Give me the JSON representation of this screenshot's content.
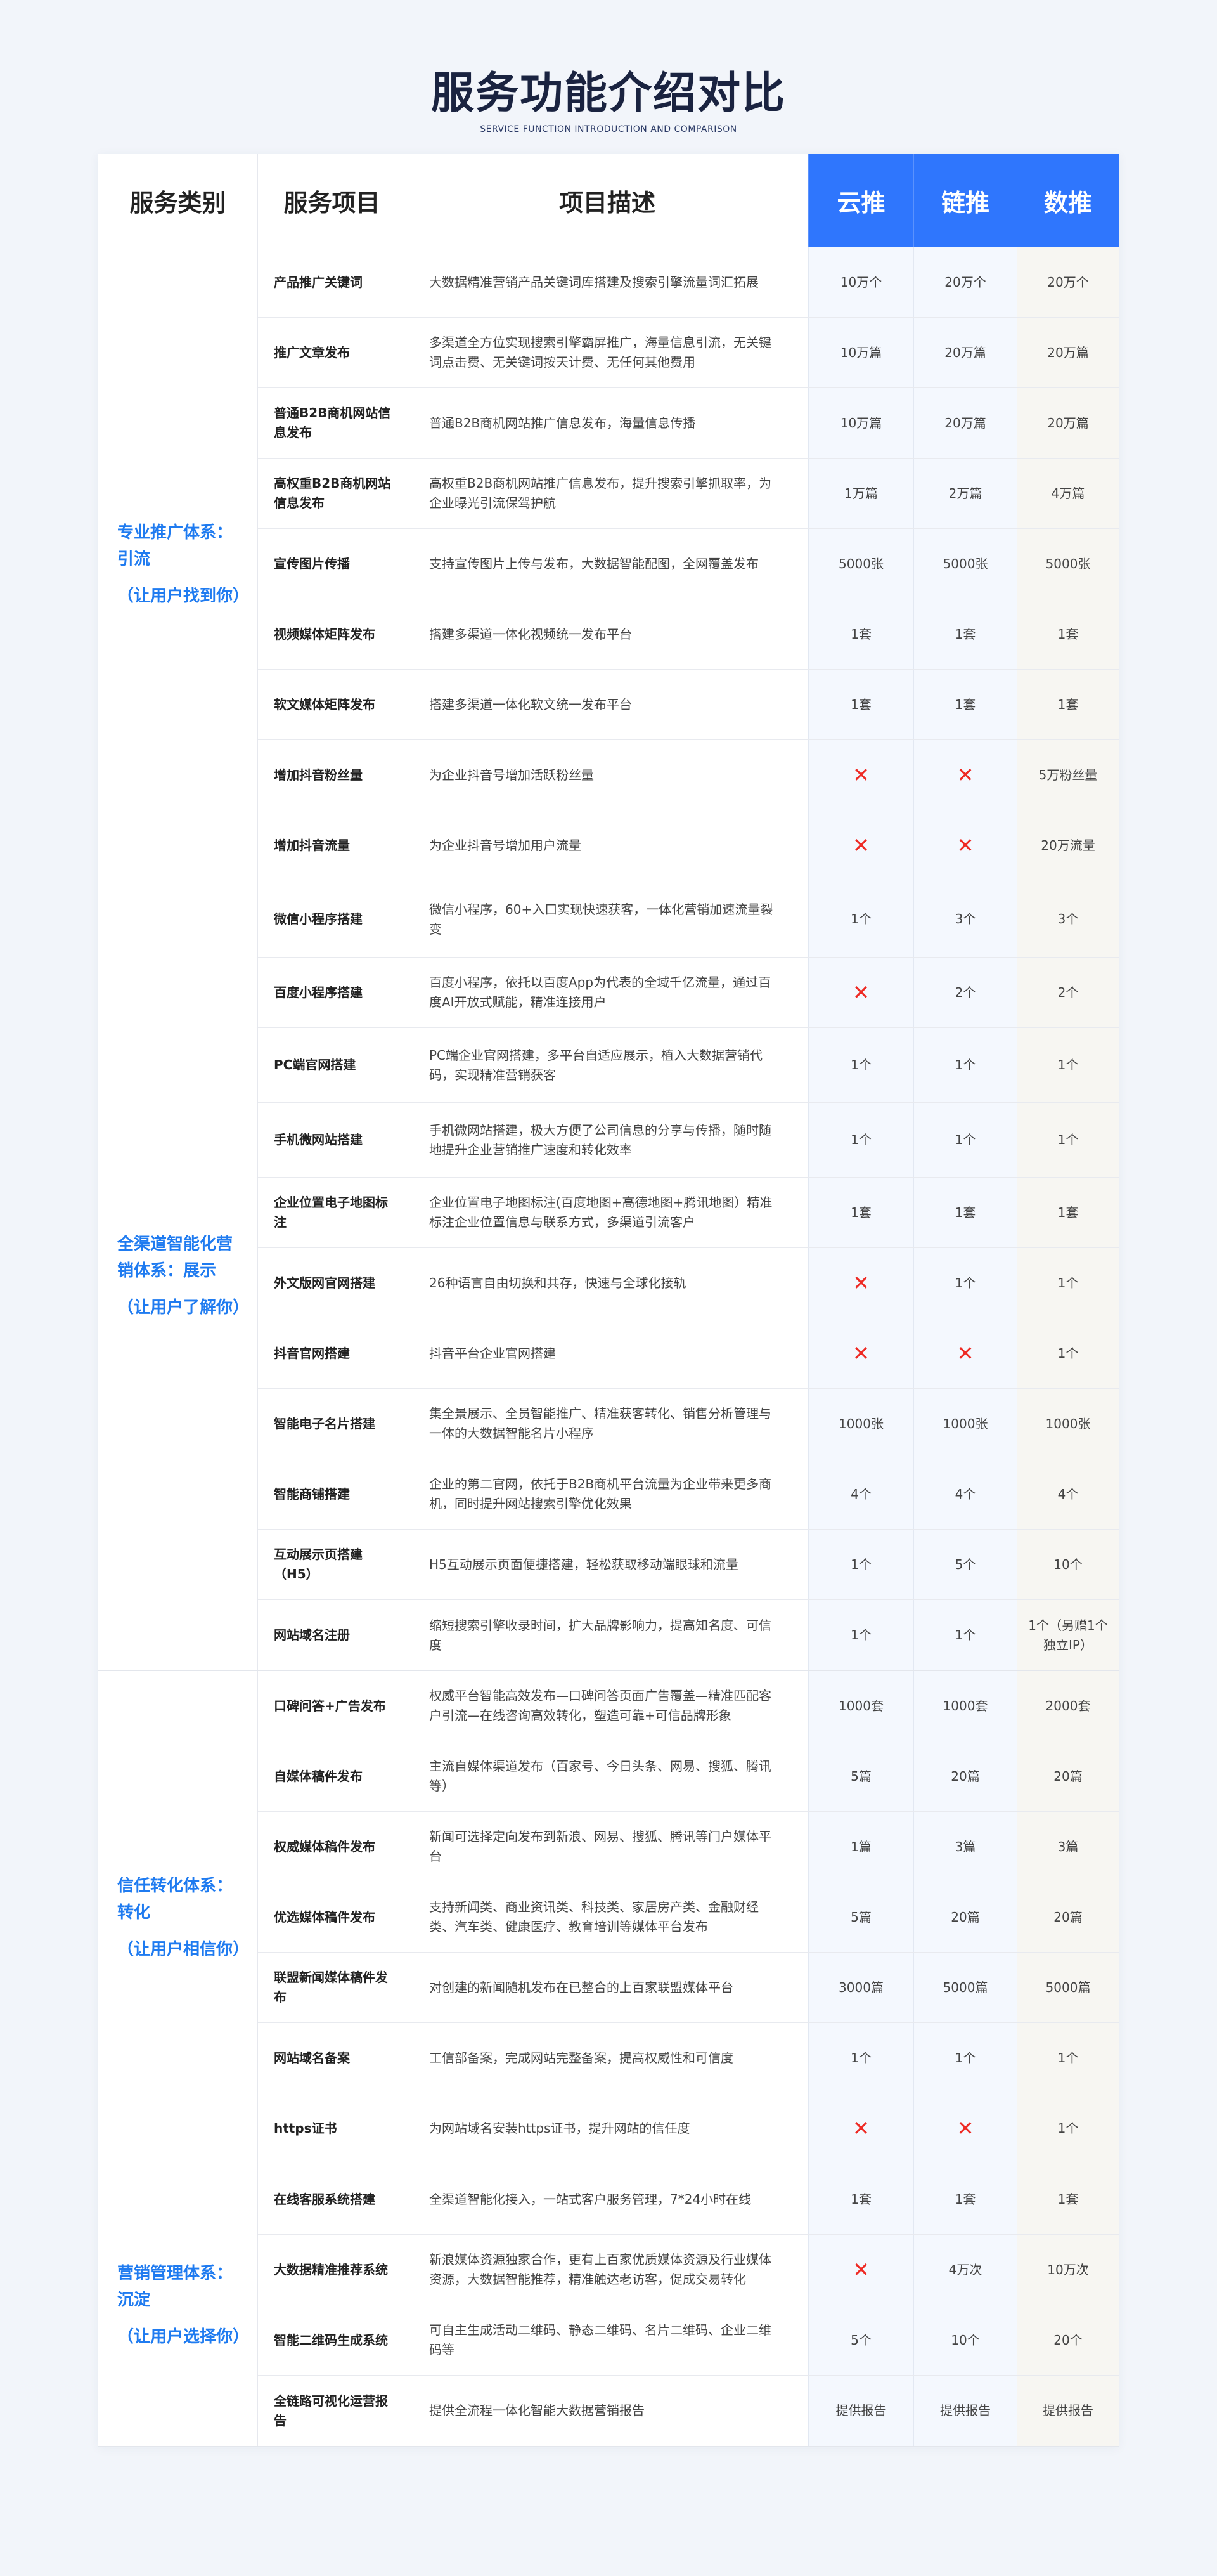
{
  "title": "服务功能介绍对比",
  "subtitle": "SERVICE FUNCTION INTRODUCTION AND COMPARISON",
  "headers": {
    "category": "服务类别",
    "item": "服务项目",
    "desc": "项目描述",
    "plan1": "云推",
    "plan2": "链推",
    "plan3": "数推"
  },
  "colors": {
    "accent": "#2f76fd",
    "category_text": "#1f7bf0",
    "cross": "#ee2a24"
  },
  "cross_icon": "red-x-icon",
  "sections": [
    {
      "title": "专业推广体系：引流",
      "sub": "（让用户找到你）",
      "rows": [
        {
          "item": "产品推广关键词",
          "desc": "大数据精准营销产品关键词库搭建及搜索引擎流量词汇拓展",
          "v": [
            "10万个",
            "20万个",
            "20万个"
          ]
        },
        {
          "item": "推广文章发布",
          "desc": "多渠道全方位实现搜索引擎霸屏推广，海量信息引流，无关键词点击费、无关键词按天计费、无任何其他费用",
          "v": [
            "10万篇",
            "20万篇",
            "20万篇"
          ]
        },
        {
          "item": "普通B2B商机网站信息发布",
          "desc": "普通B2B商机网站推广信息发布，海量信息传播",
          "v": [
            "10万篇",
            "20万篇",
            "20万篇"
          ]
        },
        {
          "item": "高权重B2B商机网站信息发布",
          "desc": "高权重B2B商机网站推广信息发布，提升搜索引擎抓取率，为企业曝光引流保驾护航",
          "v": [
            "1万篇",
            "2万篇",
            "4万篇"
          ]
        },
        {
          "item": "宣传图片传播",
          "desc": "支持宣传图片上传与发布，大数据智能配图，全网覆盖发布",
          "v": [
            "5000张",
            "5000张",
            "5000张"
          ]
        },
        {
          "item": "视频媒体矩阵发布",
          "desc": "搭建多渠道一体化视频统一发布平台",
          "v": [
            "1套",
            "1套",
            "1套"
          ]
        },
        {
          "item": "软文媒体矩阵发布",
          "desc": "搭建多渠道一体化软文统一发布平台",
          "v": [
            "1套",
            "1套",
            "1套"
          ]
        },
        {
          "item": "增加抖音粉丝量",
          "desc": "为企业抖音号增加活跃粉丝量",
          "v": [
            "x",
            "x",
            "5万粉丝量"
          ]
        },
        {
          "item": "增加抖音流量",
          "desc": "为企业抖音号增加用户流量",
          "v": [
            "x",
            "x",
            "20万流量"
          ]
        }
      ]
    },
    {
      "title": "全渠道智能化营销体系：展示",
      "sub": "（让用户了解你）",
      "rows": [
        {
          "item": "微信小程序搭建",
          "desc": "微信小程序，60+入口实现快速获客，一体化营销加速流量裂变",
          "v": [
            "1个",
            "3个",
            "3个"
          ]
        },
        {
          "item": "百度小程序搭建",
          "desc": "百度小程序，依托以百度App为代表的全域千亿流量，通过百度AI开放式赋能，精准连接用户",
          "v": [
            "x",
            "2个",
            "2个"
          ]
        },
        {
          "item": "PC端官网搭建",
          "desc": "PC端企业官网搭建，多平台自适应展示，植入大数据营销代码，实现精准营销获客",
          "v": [
            "1个",
            "1个",
            "1个"
          ]
        },
        {
          "item": "手机微网站搭建",
          "desc": "手机微网站搭建，极大方便了公司信息的分享与传播，随时随地提升企业营销推广速度和转化效率",
          "v": [
            "1个",
            "1个",
            "1个"
          ]
        },
        {
          "item": "企业位置电子地图标注",
          "desc": "企业位置电子地图标注(百度地图+高德地图+腾讯地图）精准标注企业位置信息与联系方式，多渠道引流客户",
          "v": [
            "1套",
            "1套",
            "1套"
          ]
        },
        {
          "item": "外文版网官网搭建",
          "desc": "26种语言自由切换和共存，快速与全球化接轨",
          "v": [
            "x",
            "1个",
            "1个"
          ]
        },
        {
          "item": "抖音官网搭建",
          "desc": "抖音平台企业官网搭建",
          "v": [
            "x",
            "x",
            "1个"
          ]
        },
        {
          "item": "智能电子名片搭建",
          "desc": "集全景展示、全员智能推广、精准获客转化、销售分析管理与一体的大数据智能名片小程序",
          "v": [
            "1000张",
            "1000张",
            "1000张"
          ]
        },
        {
          "item": "智能商铺搭建",
          "desc": "企业的第二官网，依托于B2B商机平台流量为企业带来更多商机，同时提升网站搜索引擎优化效果",
          "v": [
            "4个",
            "4个",
            "4个"
          ]
        },
        {
          "item": "互动展示页搭建（H5）",
          "desc": "H5互动展示页面便捷搭建，轻松获取移动端眼球和流量",
          "v": [
            "1个",
            "5个",
            "10个"
          ]
        },
        {
          "item": "网站域名注册",
          "desc": "缩短搜索引擎收录时间，扩大品牌影响力，提高知名度、可信度",
          "v": [
            "1个",
            "1个",
            "1个（另赠1个独立IP）"
          ]
        }
      ]
    },
    {
      "title": "信任转化体系：转化",
      "sub": "（让用户相信你）",
      "rows": [
        {
          "item": "口碑问答+广告发布",
          "desc": "权威平台智能高效发布—口碑问答页面广告覆盖—精准匹配客户引流—在线咨询高效转化，塑造可靠+可信品牌形象",
          "v": [
            "1000套",
            "1000套",
            "2000套"
          ]
        },
        {
          "item": "自媒体稿件发布",
          "desc": "主流自媒体渠道发布（百家号、今日头条、网易、搜狐、腾讯等）",
          "v": [
            "5篇",
            "20篇",
            "20篇"
          ]
        },
        {
          "item": "权威媒体稿件发布",
          "desc": "新闻可选择定向发布到新浪、网易、搜狐、腾讯等门户媒体平台",
          "v": [
            "1篇",
            "3篇",
            "3篇"
          ]
        },
        {
          "item": "优选媒体稿件发布",
          "desc": "支持新闻类、商业资讯类、科技类、家居房产类、金融财经类、汽车类、健康医疗、教育培训等媒体平台发布",
          "v": [
            "5篇",
            "20篇",
            "20篇"
          ]
        },
        {
          "item": "联盟新闻媒体稿件发布",
          "desc": "对创建的新闻随机发布在已整合的上百家联盟媒体平台",
          "v": [
            "3000篇",
            "5000篇",
            "5000篇"
          ]
        },
        {
          "item": "网站域名备案",
          "desc": "工信部备案，完成网站完整备案，提高权威性和可信度",
          "v": [
            "1个",
            "1个",
            "1个"
          ]
        },
        {
          "item": "https证书",
          "desc": "为网站域名安装https证书，提升网站的信任度",
          "v": [
            "x",
            "x",
            "1个"
          ]
        }
      ]
    },
    {
      "title": "营销管理体系：沉淀",
      "sub": "（让用户选择你）",
      "rows": [
        {
          "item": "在线客服系统搭建",
          "desc": "全渠道智能化接入，一站式客户服务管理，7*24小时在线",
          "v": [
            "1套",
            "1套",
            "1套"
          ]
        },
        {
          "item": "大数据精准推荐系统",
          "desc": "新浪媒体资源独家合作，更有上百家优质媒体资源及行业媒体资源，大数据智能推荐，精准触达老访客，促成交易转化",
          "v": [
            "x",
            "4万次",
            "10万次"
          ]
        },
        {
          "item": "智能二维码生成系统",
          "desc": "可自主生成活动二维码、静态二维码、名片二维码、企业二维码等",
          "v": [
            "5个",
            "10个",
            "20个"
          ]
        },
        {
          "item": "全链路可视化运营报告",
          "desc": "提供全流程一体化智能大数据营销报告",
          "v": [
            "提供报告",
            "提供报告",
            "提供报告"
          ]
        }
      ]
    }
  ]
}
